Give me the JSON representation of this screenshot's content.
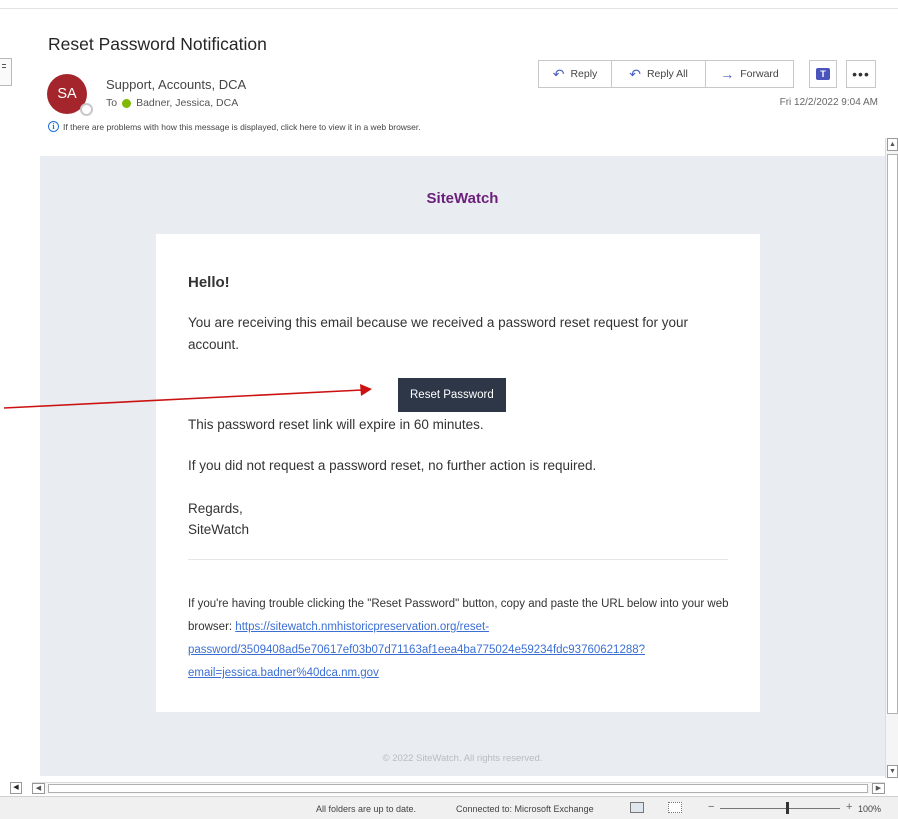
{
  "message": {
    "subject": "Reset Password Notification",
    "avatar_initials": "SA",
    "sender": "Support, Accounts, DCA",
    "to_label": "To",
    "recipient": "Badner, Jessica, DCA",
    "info_text": "If there are problems with how this message is displayed, click here to view it in a web browser.",
    "date": "Fri 12/2/2022 9:04 AM"
  },
  "actions": {
    "reply": "Reply",
    "reply_all": "Reply All",
    "forward": "Forward",
    "more": "•••"
  },
  "email": {
    "brand": "SiteWatch",
    "greeting": "Hello!",
    "intro": "You are receiving this email because we received a password reset request for your account.",
    "button_label": "Reset Password",
    "expiry": "This password reset link will expire in 60 minutes.",
    "no_action": "If you did not request a password reset, no further action is required.",
    "regards": "Regards,",
    "signature": "SiteWatch",
    "trouble_text": "If you're having trouble clicking the \"Reset Password\" button, copy and paste the URL below into your web browser: ",
    "url": "https://sitewatch.nmhistoricpreservation.org/reset-password/3509408ad5e70617ef03b07d71163af1eea4ba775024e59234fdc93760621288?email=jessica.badner%40dca.nm.gov",
    "footer": "© 2022 SiteWatch. All rights reserved."
  },
  "status": {
    "sync": "All folders are up to date.",
    "connection": "Connected to: Microsoft Exchange",
    "zoom": "100%"
  },
  "colors": {
    "avatar": "#a4262c",
    "brand": "#6b1f7a",
    "button": "#2d3748",
    "link": "#3b6fd4",
    "annotation_arrow": "#cc1111"
  },
  "icons": {
    "reply": "reply-arrow-icon",
    "reply_all": "reply-all-arrow-icon",
    "forward": "forward-arrow-icon",
    "teams": "teams-icon",
    "info": "info-icon"
  }
}
